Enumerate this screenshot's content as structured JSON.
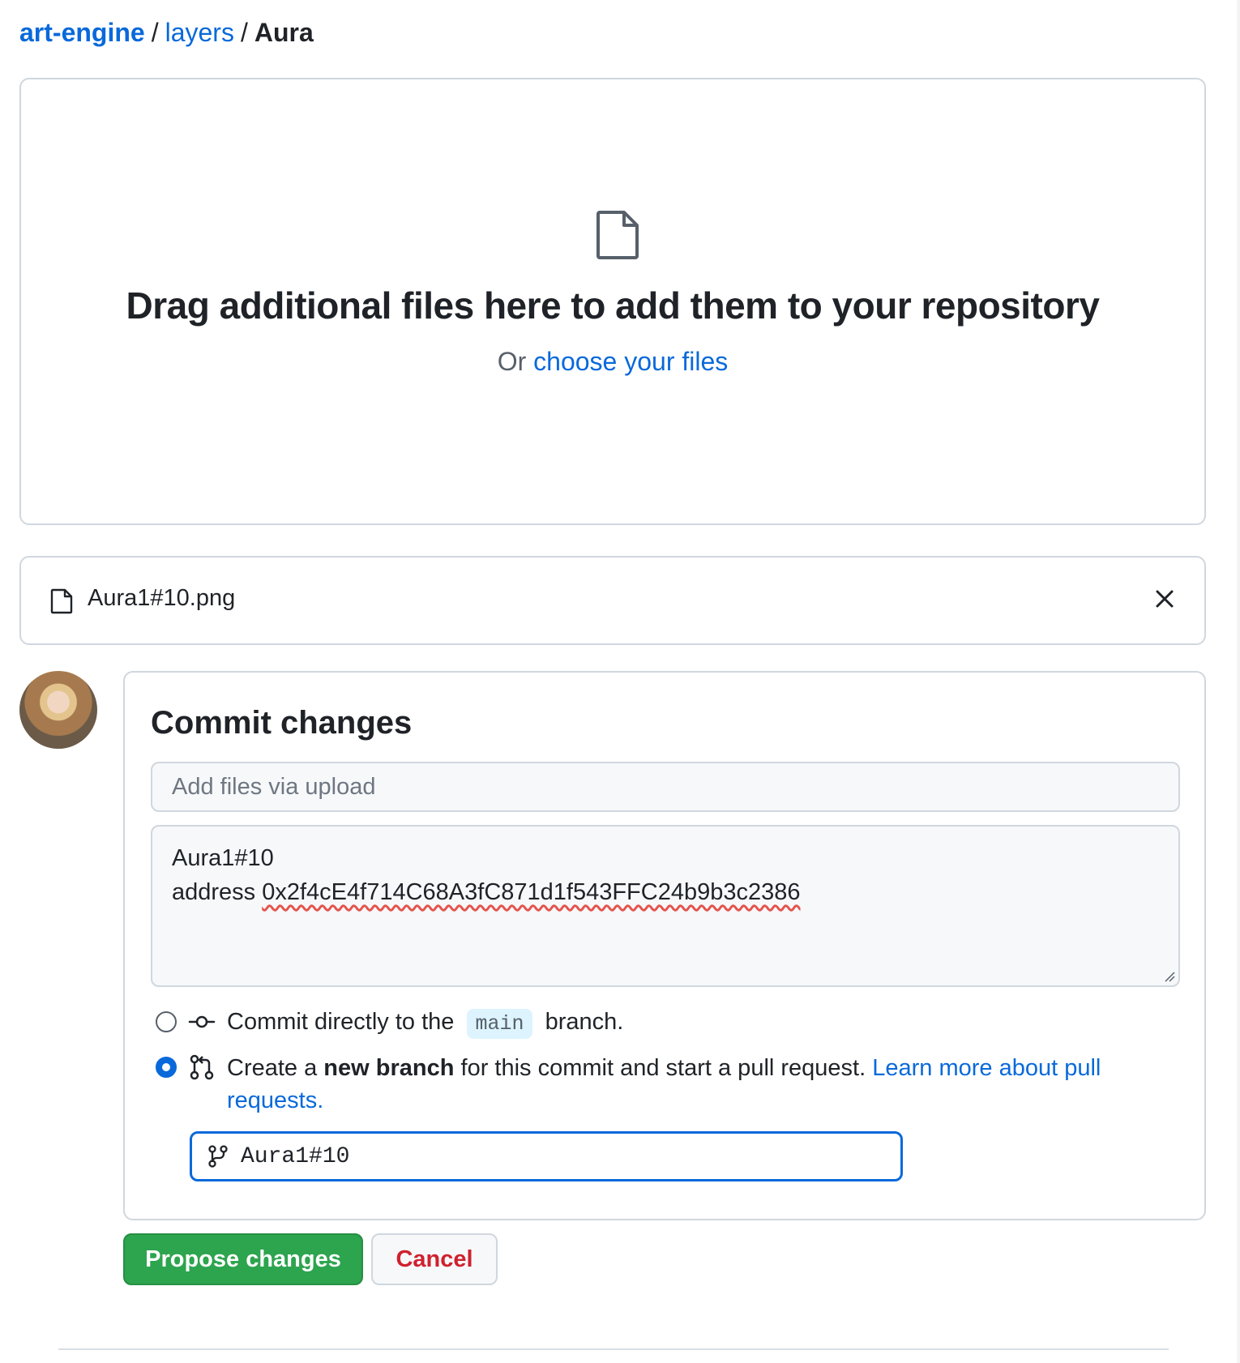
{
  "breadcrumb": {
    "repo": "art-engine",
    "folder": "layers",
    "current": "Aura",
    "separator": "/"
  },
  "dropzone": {
    "headline": "Drag additional files here to add them to your repository",
    "prefix": "Or",
    "choose_link": "choose your files"
  },
  "files": [
    {
      "name": "Aura1#10.png"
    }
  ],
  "commit": {
    "title": "Commit changes",
    "summary_placeholder": "Add files via upload",
    "description_line1": "Aura1#10",
    "description_line2_prefix": "address",
    "description_line2_address": "0x2f4cE4f714C68A3fC871d1f543FFC24b9b3c2386",
    "option_direct_before": "Commit directly to the",
    "option_direct_branch": "main",
    "option_direct_after": "branch.",
    "option_new_before": "Create a",
    "option_new_bold": "new branch",
    "option_new_after": "for this commit and start a pull request.",
    "option_new_link": "Learn more about pull requests.",
    "selected_option": "new-branch",
    "new_branch_name": "Aura1#10"
  },
  "actions": {
    "propose": "Propose changes",
    "cancel": "Cancel"
  },
  "colors": {
    "link": "#0969da",
    "primary": "#2da44e",
    "danger": "#cf222e",
    "border": "#d0d7de"
  }
}
